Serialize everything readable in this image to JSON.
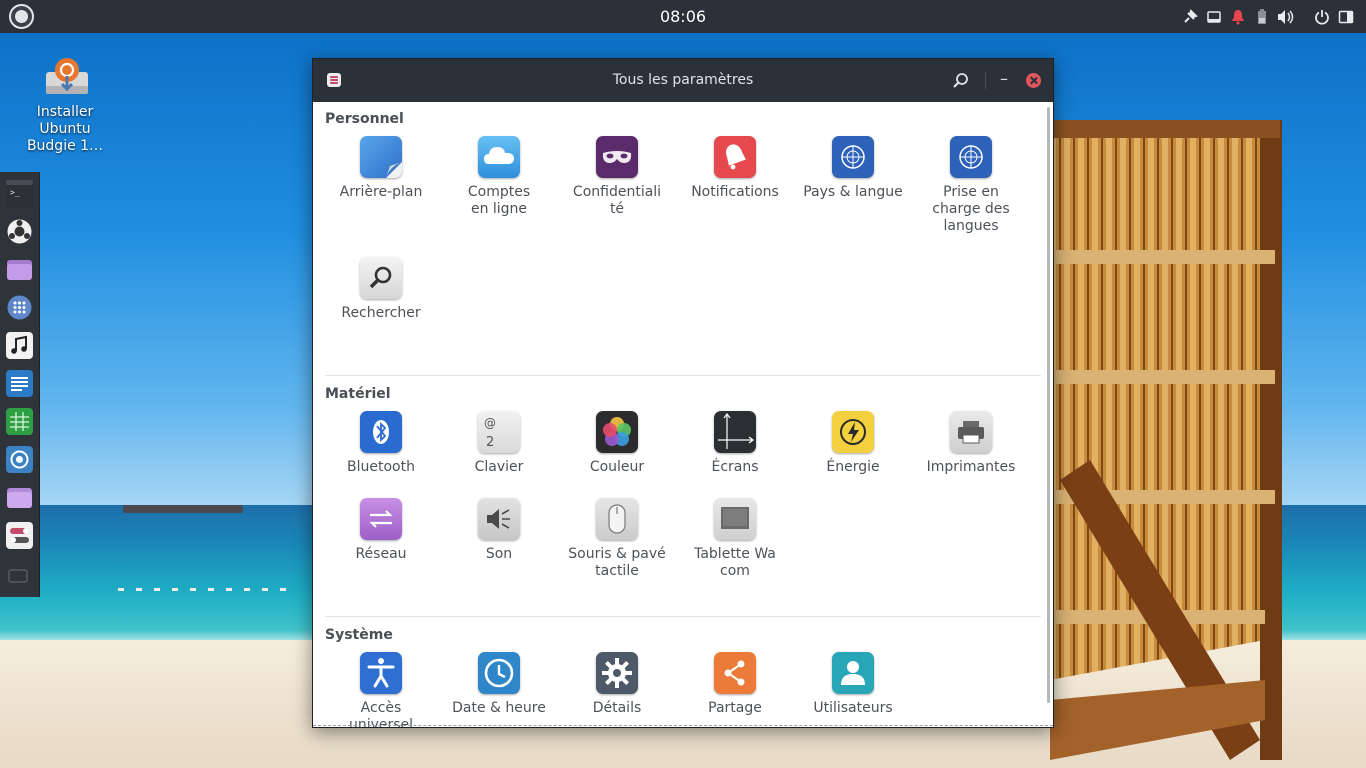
{
  "panel": {
    "clock": "08:06"
  },
  "desktop": {
    "icons": [
      {
        "label": "Installer Ubuntu Budgie 1…"
      }
    ]
  },
  "window": {
    "title": "Tous les paramètres",
    "sections": [
      {
        "title": "Personnel",
        "items": [
          {
            "label": "Arrière-plan",
            "icon": "wallpaper-icon"
          },
          {
            "label": "Comptes en ligne",
            "icon": "cloud-icon"
          },
          {
            "label": "Confidentialité",
            "icon": "privacy-mask-icon"
          },
          {
            "label": "Notifications",
            "icon": "bell-icon"
          },
          {
            "label": "Pays & langue",
            "icon": "globe-icon"
          },
          {
            "label": "Prise en charge des langues",
            "icon": "globe-icon"
          },
          {
            "label": "Rechercher",
            "icon": "magnifier-icon"
          }
        ]
      },
      {
        "title": "Matériel",
        "items": [
          {
            "label": "Bluetooth",
            "icon": "bluetooth-icon"
          },
          {
            "label": "Clavier",
            "icon": "keyboard-icon"
          },
          {
            "label": "Couleur",
            "icon": "color-icon"
          },
          {
            "label": "Écrans",
            "icon": "display-icon"
          },
          {
            "label": "Énergie",
            "icon": "power-icon"
          },
          {
            "label": "Imprimantes",
            "icon": "printer-icon"
          },
          {
            "label": "Réseau",
            "icon": "network-icon"
          },
          {
            "label": "Son",
            "icon": "speaker-icon"
          },
          {
            "label": "Souris & pavé tactile",
            "icon": "mouse-icon"
          },
          {
            "label": "Tablette Wacom",
            "icon": "tablet-icon"
          }
        ]
      },
      {
        "title": "Système",
        "items": [
          {
            "label": "Accès universel",
            "icon": "accessibility-icon"
          },
          {
            "label": "Date & heure",
            "icon": "clock-icon"
          },
          {
            "label": "Détails",
            "icon": "gear-icon"
          },
          {
            "label": "Partage",
            "icon": "share-icon"
          },
          {
            "label": "Utilisateurs",
            "icon": "user-icon"
          }
        ]
      }
    ]
  },
  "dock": {
    "apps": [
      "terminal-icon",
      "software-icon",
      "files-icon",
      "settings-grid-icon",
      "music-icon",
      "writer-icon",
      "calc-icon",
      "chromium-icon",
      "folder-icon",
      "toggle-icon"
    ]
  },
  "colors": {
    "panel_bg": "#2b3138",
    "accent_close": "#e0555e"
  }
}
